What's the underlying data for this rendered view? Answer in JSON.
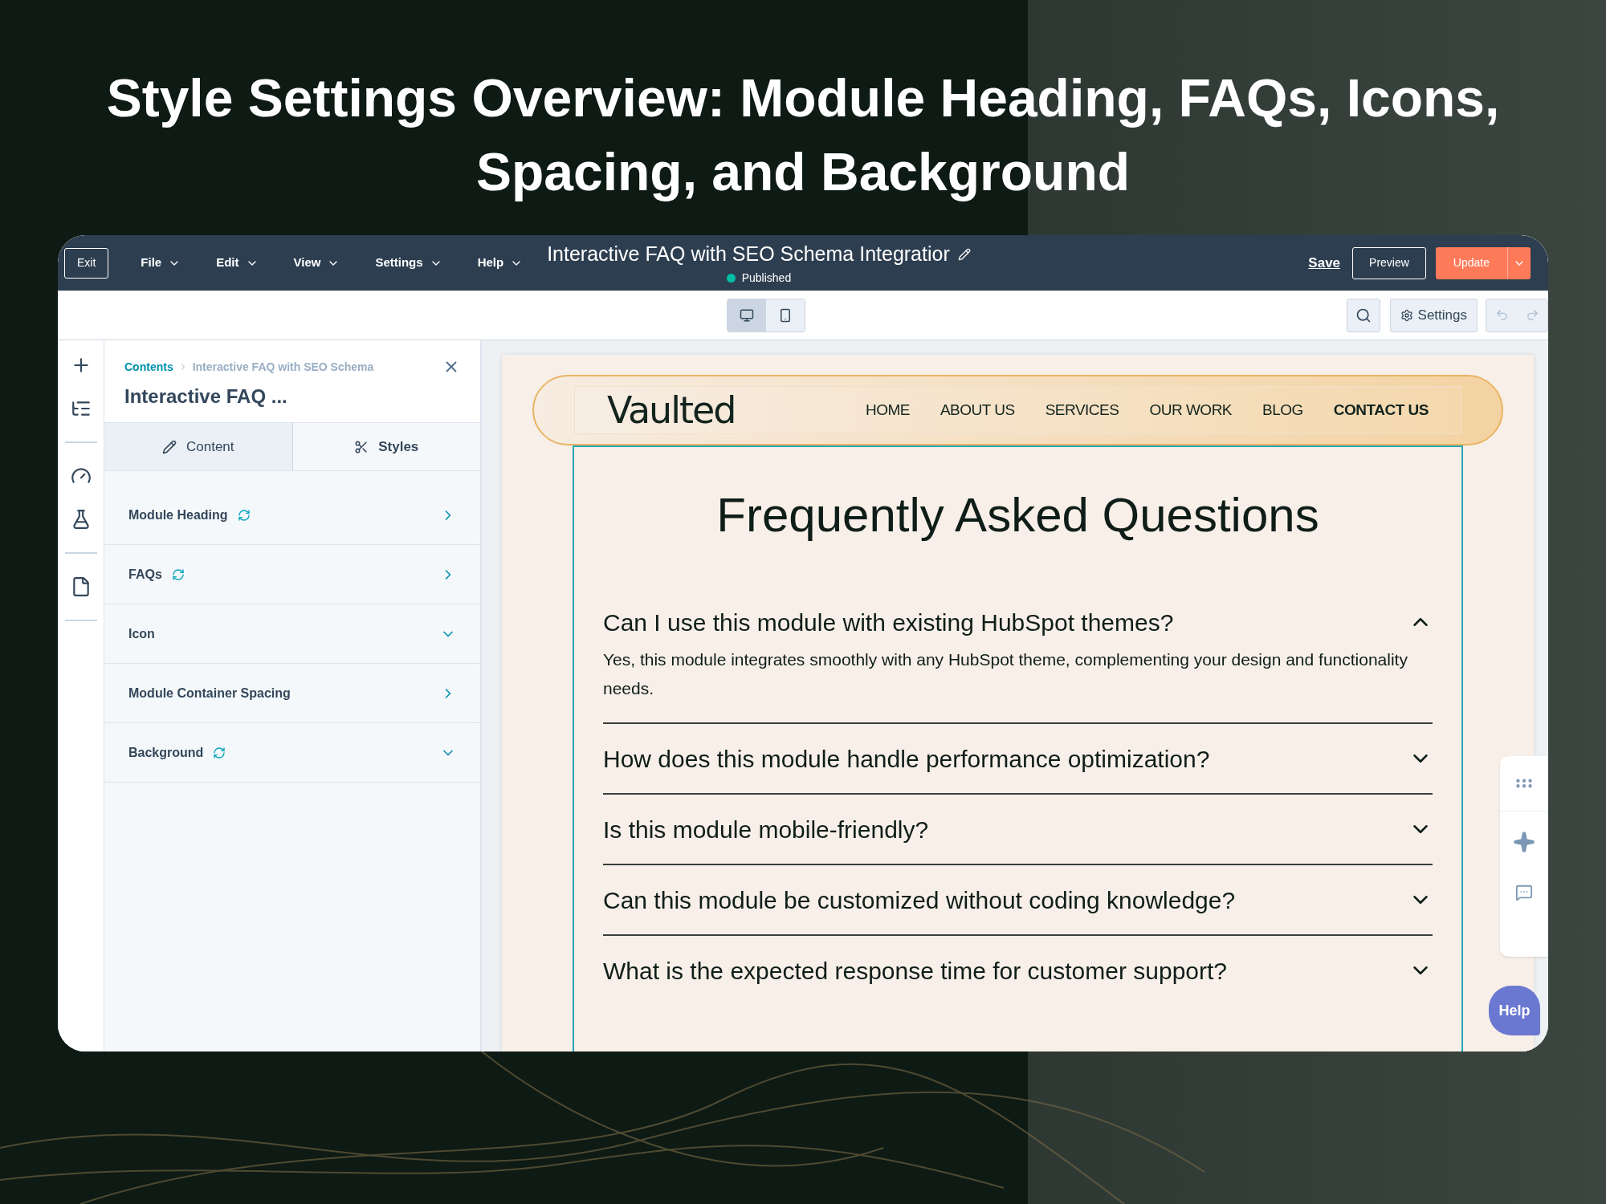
{
  "headline": {
    "lines": [
      "Style Settings Overview: Module Heading, FAQs, Icons,",
      "Spacing, and Background"
    ]
  },
  "top_bar": {
    "exit": "Exit",
    "menus": [
      "File",
      "Edit",
      "View",
      "Settings",
      "Help"
    ],
    "document_title": "Interactive FAQ with SEO Schema Integratior",
    "status": {
      "label": "Published",
      "color": "#00bda5"
    },
    "save": "Save",
    "preview": "Preview",
    "update": "Update"
  },
  "toolbar": {
    "devices": [
      {
        "kind": "desktop",
        "selected": true
      },
      {
        "kind": "mobile",
        "selected": false
      }
    ],
    "settings": "Settings",
    "undo_disabled": true
  },
  "sidebar": {
    "breadcrumb": [
      "Contents",
      "Interactive FAQ with SEO Schema"
    ],
    "title": "Interactive FAQ ...",
    "tabs": [
      {
        "label": "Content",
        "kind": "content",
        "selected": false
      },
      {
        "label": "Styles",
        "kind": "styles",
        "selected": true
      }
    ],
    "sections": [
      {
        "label": "Module Heading",
        "synced": true,
        "dropdown": false
      },
      {
        "label": "FAQs",
        "synced": true,
        "dropdown": false
      },
      {
        "label": "Icon",
        "synced": false,
        "dropdown": true
      },
      {
        "label": "Module Container Spacing",
        "synced": false,
        "dropdown": false
      },
      {
        "label": "Background",
        "synced": true,
        "dropdown": true
      }
    ]
  },
  "preview": {
    "logo": "Vaulted",
    "nav": [
      {
        "label": "HOME",
        "selected": false
      },
      {
        "label": "ABOUT US",
        "selected": false
      },
      {
        "label": "SERVICES",
        "selected": false
      },
      {
        "label": "OUR WORK",
        "selected": false
      },
      {
        "label": "BLOG",
        "selected": false
      },
      {
        "label": "CONTACT US",
        "selected": true
      }
    ],
    "heading": "Frequently Asked Questions",
    "faqs": [
      {
        "question": "Can I use this module with existing HubSpot themes?",
        "expanded": true,
        "answer": "Yes, this module integrates smoothly with any HubSpot theme, complementing your design and functionality needs."
      },
      {
        "question": "How does this module handle performance optimization?",
        "expanded": false
      },
      {
        "question": "Is this module mobile-friendly?",
        "expanded": false
      },
      {
        "question": "Can this module be customized without coding knowledge?",
        "expanded": false
      },
      {
        "question": "What is the expected response time for customer support?",
        "expanded": false
      }
    ]
  },
  "help": "Help"
}
